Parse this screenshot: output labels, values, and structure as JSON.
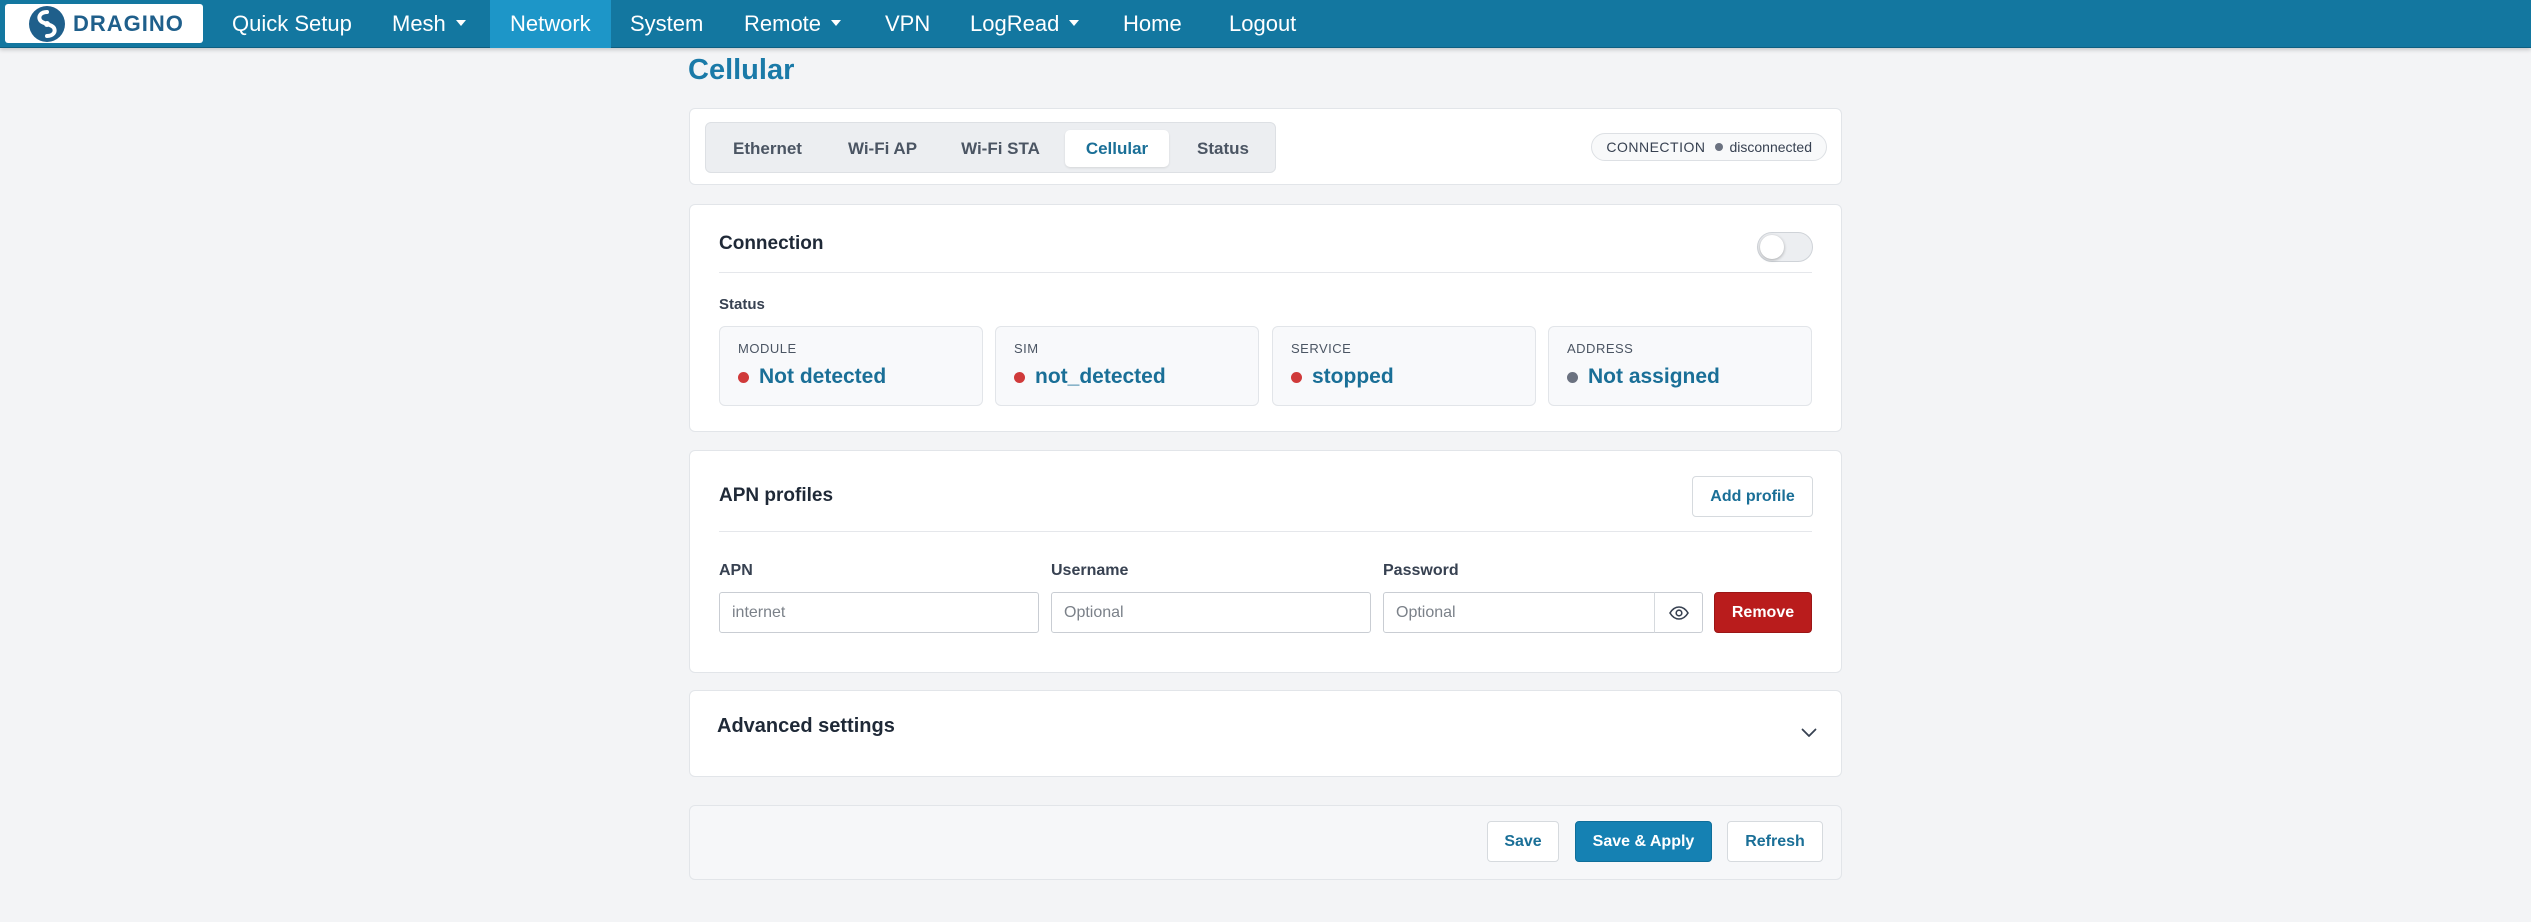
{
  "brand": {
    "logo_text": "DRAGINO"
  },
  "nav": {
    "items": [
      {
        "label": "Quick Setup",
        "dropdown": false
      },
      {
        "label": "Mesh",
        "dropdown": true
      },
      {
        "label": "Network",
        "dropdown": false,
        "active": true
      },
      {
        "label": "System",
        "dropdown": false
      },
      {
        "label": "Remote",
        "dropdown": true
      },
      {
        "label": "VPN",
        "dropdown": false
      },
      {
        "label": "LogRead",
        "dropdown": true
      },
      {
        "label": "Home",
        "dropdown": false
      },
      {
        "label": "Logout",
        "dropdown": false
      }
    ]
  },
  "page": {
    "title": "Cellular"
  },
  "tabs": [
    {
      "label": "Ethernet"
    },
    {
      "label": "Wi-Fi AP"
    },
    {
      "label": "Wi-Fi STA"
    },
    {
      "label": "Cellular",
      "active": true
    },
    {
      "label": "Status"
    }
  ],
  "connection_badge": {
    "label": "CONNECTION",
    "value": "disconnected"
  },
  "connection": {
    "title": "Connection",
    "enabled": false,
    "status_label": "Status",
    "stats": [
      {
        "key": "MODULE",
        "value": "Not detected",
        "color": "#d03a3a"
      },
      {
        "key": "SIM",
        "value": "not_detected",
        "color": "#d03a3a"
      },
      {
        "key": "SERVICE",
        "value": "stopped",
        "color": "#d03a3a"
      },
      {
        "key": "ADDRESS",
        "value": "Not assigned",
        "color": "#6b7280"
      }
    ]
  },
  "apn": {
    "title": "APN profiles",
    "add_label": "Add profile",
    "apn_label": "APN",
    "apn_placeholder": "internet",
    "username_label": "Username",
    "username_placeholder": "Optional",
    "password_label": "Password",
    "password_placeholder": "Optional",
    "remove_label": "Remove"
  },
  "advanced": {
    "title": "Advanced settings"
  },
  "actions": {
    "save": "Save",
    "save_apply": "Save & Apply",
    "refresh": "Refresh"
  },
  "colors": {
    "navbar": "#1377a0",
    "nav_active": "#1d96c8",
    "accent": "#1a7aa8",
    "danger": "#b91c1c"
  }
}
